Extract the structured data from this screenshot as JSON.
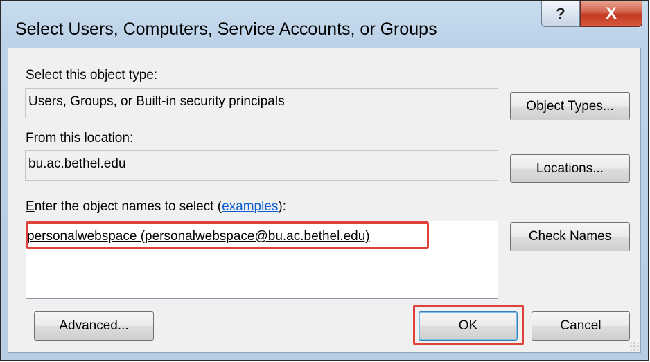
{
  "window": {
    "title": "Select Users, Computers, Service Accounts, or Groups",
    "help_glyph": "?",
    "close_glyph": "X"
  },
  "object_type": {
    "label": "Select this object type:",
    "value": "Users, Groups, or Built-in security principals",
    "button": "Object Types..."
  },
  "location": {
    "label": "From this location:",
    "value": "bu.ac.bethel.edu",
    "button": "Locations..."
  },
  "names": {
    "label_accel": "E",
    "label_rest": "nter the object names to select (",
    "link": "examples",
    "label_end": "):",
    "entry": "personalwebspace (personalwebspace@bu.ac.bethel.edu)",
    "check_button": "Check Names"
  },
  "footer": {
    "advanced_button": "Advanced...",
    "ok_button": "OK",
    "cancel_button": "Cancel"
  },
  "colors": {
    "highlight": "#e0403a",
    "link": "#0a5ed0"
  }
}
